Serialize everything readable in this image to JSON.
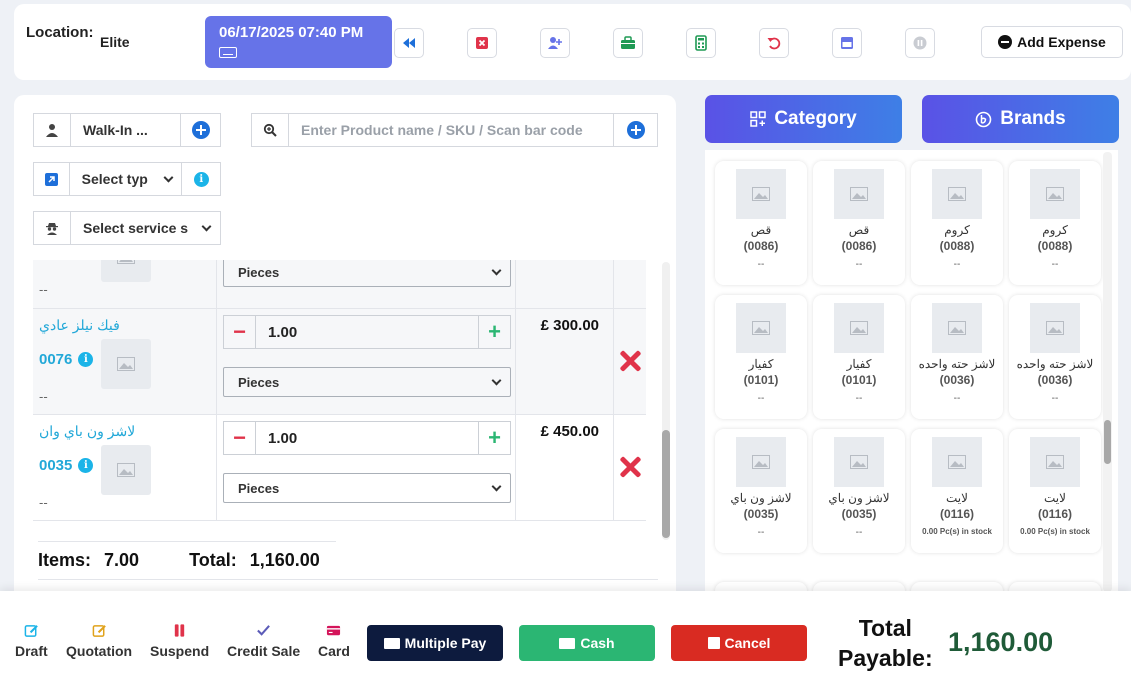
{
  "header": {
    "location_label": "Location:",
    "location_value": "Elite",
    "datetime": "06/17/2025 07:40 PM",
    "toolbar_icons": [
      "rewind-icon",
      "close-square-icon",
      "add-user-icon",
      "briefcase-icon",
      "calculator-icon",
      "undo-icon",
      "window-icon",
      "pause-icon"
    ],
    "add_expense_label": "Add Expense"
  },
  "controls": {
    "customer_value": "Walk-In ...",
    "search_placeholder": "Enter Product name / SKU / Scan bar code",
    "type_value": "Select typ",
    "service_value": "Select service s"
  },
  "cart": {
    "rows": [
      {
        "name": "",
        "sku": "",
        "qty": "",
        "unit": "Pieces",
        "price": "",
        "dash": "--"
      },
      {
        "name": "فيك نيلز عادي",
        "sku": "0076",
        "qty": "1.00",
        "unit": "Pieces",
        "price": "£ 300.00",
        "dash": "--"
      },
      {
        "name": "لاشز ون باي وان",
        "sku": "0035",
        "qty": "1.00",
        "unit": "Pieces",
        "price": "£ 450.00",
        "dash": "--"
      }
    ]
  },
  "totals": {
    "items_label": "Items:",
    "items_value": "7.00",
    "total_label": "Total:",
    "total_value": "1,160.00"
  },
  "right": {
    "category_label": "Category",
    "brands_label": "Brands",
    "products": [
      {
        "name": "قص",
        "code": "(0086)",
        "stock": "--"
      },
      {
        "name": "قص",
        "code": "(0086)",
        "stock": "--"
      },
      {
        "name": "كروم",
        "code": "(0088)",
        "stock": "--"
      },
      {
        "name": "كروم",
        "code": "(0088)",
        "stock": "--"
      },
      {
        "name": "كفيار",
        "code": "(0101)",
        "stock": "--"
      },
      {
        "name": "كفيار",
        "code": "(0101)",
        "stock": "--"
      },
      {
        "name": "لاشز حته واحده",
        "code": "(0036)",
        "stock": "--"
      },
      {
        "name": "لاشز حته واحده",
        "code": "(0036)",
        "stock": "--"
      },
      {
        "name": "لاشز ون باي",
        "code": "(0035)",
        "stock": "--"
      },
      {
        "name": "لاشز ون باي",
        "code": "(0035)",
        "stock": "--"
      },
      {
        "name": "لايت",
        "code": "(0116)",
        "stock": "0.00 Pc(s) in stock"
      },
      {
        "name": "لايت",
        "code": "(0116)",
        "stock": "0.00 Pc(s) in stock"
      }
    ]
  },
  "bottom": {
    "draft": "Draft",
    "quotation": "Quotation",
    "suspend": "Suspend",
    "credit_sale": "Credit Sale",
    "card": "Card",
    "multiple_pay": "Multiple Pay",
    "cash": "Cash",
    "cancel": "Cancel",
    "total_payable_line1": "Total",
    "total_payable_line2": "Payable:",
    "total_payable_value": "1,160.00"
  },
  "colors": {
    "accent": "#6673e8",
    "cash": "#2bb673",
    "cancel": "#d92b22",
    "multiple_pay": "#0d1b3e",
    "total_value": "#1f5b38",
    "sku_text": "#22a8d8"
  }
}
